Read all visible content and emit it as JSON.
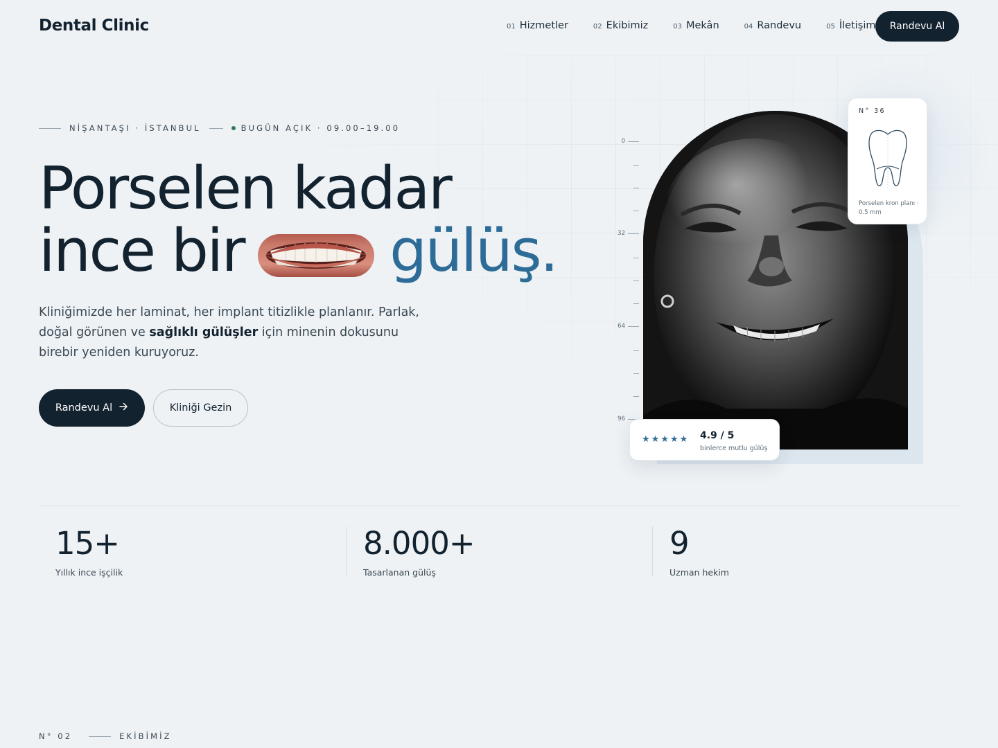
{
  "header": {
    "brand": "Dental Clinic",
    "nav": [
      {
        "num": "01",
        "label": "Hizmetler"
      },
      {
        "num": "02",
        "label": "Ekibimiz"
      },
      {
        "num": "03",
        "label": "Mekân"
      },
      {
        "num": "04",
        "label": "Randevu"
      },
      {
        "num": "05",
        "label": "İletişim"
      }
    ],
    "cta": "Randevu Al"
  },
  "hero": {
    "location": "NİŞANTAŞI · İSTANBUL",
    "status": "BUGÜN AÇIK · 09.00–19.00",
    "headline_line1": "Porselen kadar",
    "headline_line2_a": "ince bir",
    "headline_accent": "gülüş.",
    "lead_a": "Kliniğimizde her laminat, her implant titizlikle planlanır. Parlak, doğal görünen ve ",
    "lead_bold": "sağlıklı gülüşler",
    "lead_b": " için minenin dokusunu birebir yeniden kuruyoruz.",
    "primary_button": "Randevu Al",
    "secondary_button": "Kliniği Gezin"
  },
  "ruler": {
    "labels": [
      "0",
      "32",
      "64",
      "96"
    ]
  },
  "tooth_card": {
    "number": "N° 36",
    "caption": "Porselen kron planı · 0.5 mm"
  },
  "rating": {
    "value": "4.9 / 5",
    "subtitle": "binlerce mutlu gülüş",
    "stars": 5
  },
  "stats": [
    {
      "value": "15+",
      "label": "Yıllık ince işçilik"
    },
    {
      "value": "8.000+",
      "label": "Tasarlanan gülüş"
    },
    {
      "value": "9",
      "label": "Uzman hekim"
    }
  ],
  "next_section": {
    "number": "N° 02",
    "title": "EKİBİMİZ"
  },
  "colors": {
    "ink": "#13222f",
    "accent": "#2e6c98",
    "background": "#eef2f5",
    "open_dot": "#2f7a55"
  }
}
